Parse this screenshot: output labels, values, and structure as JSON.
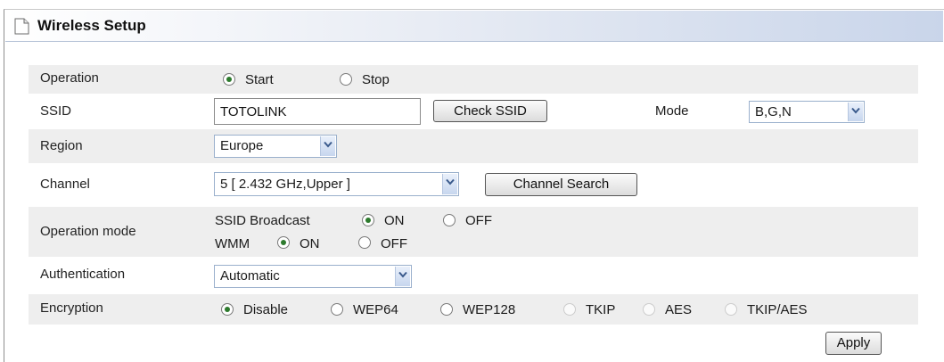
{
  "title": "Wireless Setup",
  "operation": {
    "label": "Operation",
    "options": [
      "Start",
      "Stop"
    ],
    "selected": "Start"
  },
  "ssid": {
    "label": "SSID",
    "value": "TOTOLINK",
    "check_button": "Check SSID",
    "mode_label": "Mode",
    "mode_value": "B,G,N"
  },
  "region": {
    "label": "Region",
    "value": "Europe"
  },
  "channel": {
    "label": "Channel",
    "value": "5 [ 2.432 GHz,Upper ]",
    "search_button": "Channel Search"
  },
  "operation_mode": {
    "label": "Operation mode",
    "ssid_broadcast_label": "SSID Broadcast",
    "ssid_broadcast_on": "ON",
    "ssid_broadcast_off": "OFF",
    "wmm_label": "WMM",
    "wmm_on": "ON",
    "wmm_off": "OFF"
  },
  "authentication": {
    "label": "Authentication",
    "value": "Automatic"
  },
  "encryption": {
    "label": "Encryption",
    "options": [
      "Disable",
      "WEP64",
      "WEP128",
      "TKIP",
      "AES",
      "TKIP/AES"
    ],
    "selected": "Disable"
  },
  "apply_button": "Apply",
  "icons": {
    "title": "document-icon",
    "dropdown": "chevron-down-icon"
  }
}
